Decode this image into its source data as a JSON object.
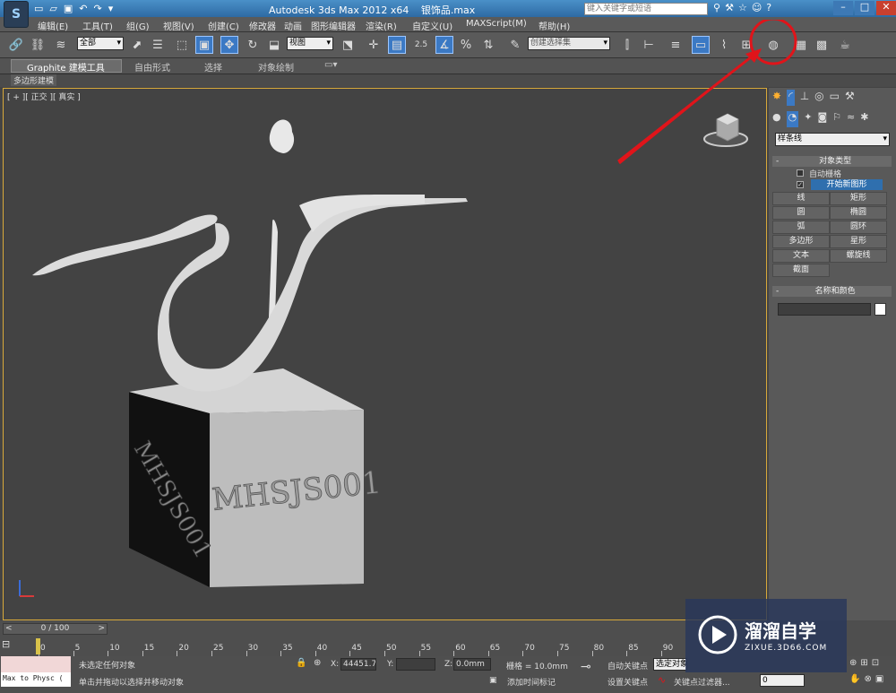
{
  "title_bar": {
    "app_title": "Autodesk 3ds Max  2012 x64",
    "file_name": "银饰品.max",
    "search_placeholder": "键入关键字或短语"
  },
  "menu": [
    "编辑(E)",
    "工具(T)",
    "组(G)",
    "视图(V)",
    "创建(C)",
    "修改器",
    "动画",
    "图形编辑器",
    "渲染(R)",
    "自定义(U)",
    "MAXScript(M)",
    "帮助(H)"
  ],
  "toolbar": {
    "selection_filter": "全部",
    "view_dropdown": "视图",
    "snap_value": "2.5",
    "named_selection": "创建选择集"
  },
  "ribbon": {
    "tabs": [
      "Graphite 建模工具",
      "自由形式",
      "选择",
      "对象绘制"
    ],
    "sub_label": "多边形建模"
  },
  "viewport": {
    "label": "[ + ][ 正交 ][ 真实 ]",
    "engraving": "MHSJS001"
  },
  "command_panel": {
    "dropdown": "样条线",
    "object_type_title": "对象类型",
    "auto_grid": "自动栅格",
    "start_new_shape": "开始新图形",
    "buttons": [
      "线",
      "矩形",
      "圆",
      "椭圆",
      "弧",
      "圆环",
      "多边形",
      "星形",
      "文本",
      "螺旋线",
      "截面"
    ],
    "name_color_title": "名称和颜色"
  },
  "timeline": {
    "frame_label": "0 / 100",
    "ticks": [
      "0",
      "5",
      "10",
      "15",
      "20",
      "25",
      "30",
      "35",
      "40",
      "45",
      "50",
      "55",
      "60",
      "65",
      "70",
      "75",
      "80",
      "85",
      "90"
    ]
  },
  "status": {
    "script_listener": "Max to Physc (",
    "selection_status": "未选定任何对象",
    "prompt": "单击并拖动以选择并移动对象",
    "x_label": "X:",
    "x_value": "44451.734",
    "y_label": "Y:",
    "y_value": "",
    "z_label": "Z:",
    "z_value": "0.0mm",
    "grid": "栅格 = 10.0mm",
    "add_time_tag": "添加时间标记",
    "auto_key": "自动关键点",
    "selected_object": "选定对象",
    "set_key": "设置关键点",
    "key_filters": "关键点过滤器...",
    "frame": "0"
  },
  "watermark": {
    "brand": "溜溜自学",
    "url": "ZIXUE.3D66.COM"
  },
  "colors": {
    "accent_blue": "#2f6fae",
    "viewport_border": "#d8a93a",
    "annotation_red": "#e0141a"
  }
}
